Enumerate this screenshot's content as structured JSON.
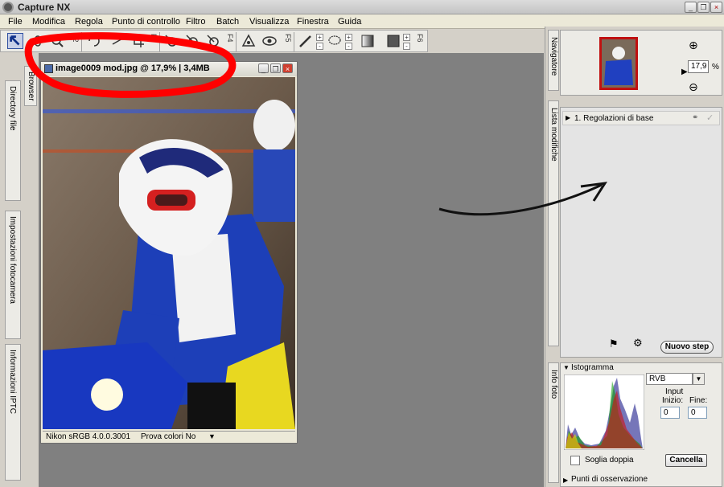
{
  "app": {
    "title": "Capture NX"
  },
  "menu": [
    "File",
    "Modifica",
    "Regola",
    "Punto di controllo",
    "Filtro",
    "Batch",
    "Visualizza",
    "Finestra",
    "Guida"
  ],
  "toolbar": {
    "groups": [
      "F2",
      "F3",
      "F4",
      "F5",
      "F6"
    ]
  },
  "left_dock": {
    "tabs": [
      "Directory file",
      "Impostazioni fotocamera",
      "Informazioni IPTC"
    ],
    "browser_tab": "Browser"
  },
  "image_window": {
    "title": "image0009 mod.jpg @ 17,9% | 3,4MB",
    "status_profile": "Nikon sRGB 4.0.0.3001",
    "status_proof": "Prova colori No"
  },
  "navigator": {
    "tab": "Navigatore",
    "zoom_value": "17,9",
    "zoom_unit": "%"
  },
  "edit_list": {
    "tab": "Lista modifiche",
    "step_label": "1. Regolazioni di base",
    "new_step_button": "Nuovo step"
  },
  "photo_info": {
    "tab": "Info foto",
    "histogram_title": "Istogramma",
    "channel": "RVB",
    "input_label": "Input",
    "start_label": "Inizio:",
    "end_label": "Fine:",
    "start_value": "0",
    "end_value": "0",
    "double_threshold": "Soglia doppia",
    "cancel_button": "Cancella",
    "watch_points": "Punti di osservazione"
  },
  "colors": {
    "workspace": "#808080",
    "accent_blue": "#1b3fb3",
    "annotation_red": "#ff0000",
    "annotation_black": "#111111"
  }
}
